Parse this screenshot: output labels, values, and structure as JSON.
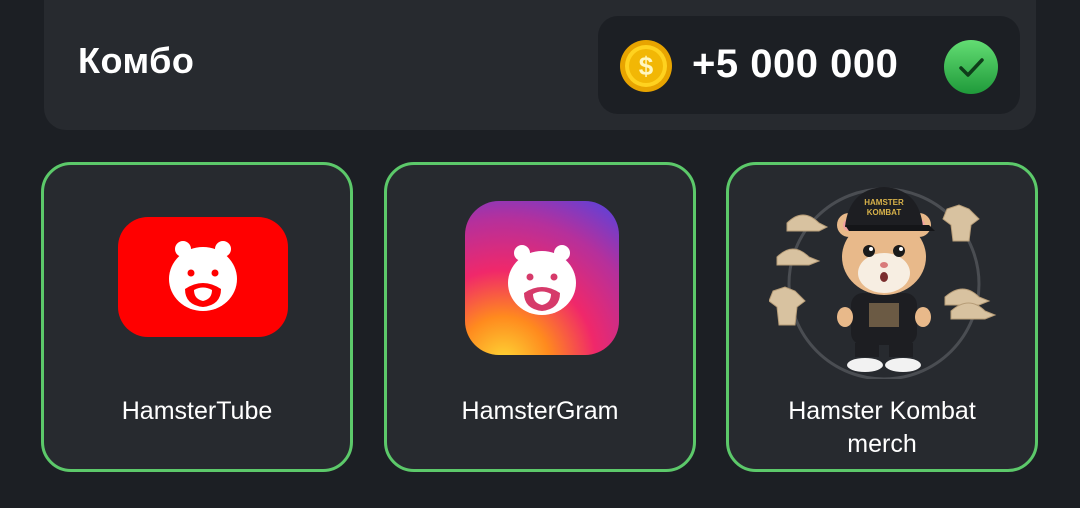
{
  "combo": {
    "title": "Комбо",
    "reward": "+5 000 000",
    "coin_icon": "dollar-coin-icon",
    "status_icon": "check-circle-icon",
    "accent_color": "#5cc96a"
  },
  "cards": [
    {
      "label": "HamsterTube",
      "icon": "hamstertube-logo",
      "color": "#ff0000"
    },
    {
      "label": "HamsterGram",
      "icon": "hamstergram-logo",
      "color": "#c13584"
    },
    {
      "label_line1": "Hamster Kombat",
      "label_line2": "merch",
      "icon": "hamster-merch-image"
    }
  ]
}
